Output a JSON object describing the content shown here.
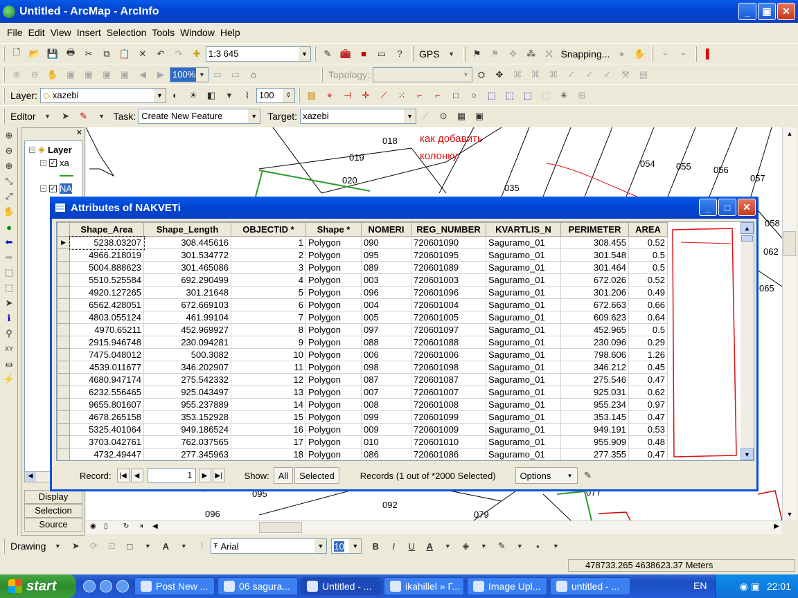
{
  "window": {
    "title": "Untitled - ArcMap - ArcInfo"
  },
  "menu": [
    "File",
    "Edit",
    "View",
    "Insert",
    "Selection",
    "Tools",
    "Window",
    "Help"
  ],
  "standard_toolbar": {
    "scale": "1:3 645",
    "gps_label": "GPS",
    "snapping_label": "Snapping..."
  },
  "layout_toolbar": {
    "zoom": "100%",
    "topology_label": "Topology:"
  },
  "effects_toolbar": {
    "layer_label": "Layer:",
    "layer_value": "xazebi",
    "transparency": "100"
  },
  "editor_toolbar": {
    "editor_label": "Editor",
    "task_label": "Task:",
    "task_value": "Create New Feature",
    "target_label": "Target:",
    "target_value": "xazebi"
  },
  "toc": {
    "layers_label": "Layer",
    "item1": "xa",
    "item2": "NA",
    "tabs": [
      "Display",
      "Selection",
      "Source"
    ]
  },
  "map": {
    "parcel_labels": [
      "018",
      "019",
      "020",
      "035",
      "054",
      "055",
      "056",
      "057",
      "058",
      "062",
      "065",
      "095",
      "092",
      "096",
      "079",
      "077"
    ],
    "annotation": [
      "как добавить",
      "колонку"
    ]
  },
  "attributes_dialog": {
    "title": "Attributes of NAKVETi",
    "columns": [
      "Shape_Area",
      "Shape_Length",
      "OBJECTID *",
      "Shape *",
      "NOMERI",
      "REG_NUMBER",
      "KVARTLIS_N",
      "PERIMETER",
      "AREA"
    ],
    "rows": [
      [
        "5238.03207",
        "308.445616",
        "1",
        "Polygon",
        "090",
        "720601090",
        "Saguramo_01",
        "308.455",
        "0.52"
      ],
      [
        "4966.218019",
        "301.534772",
        "2",
        "Polygon",
        "095",
        "720601095",
        "Saguramo_01",
        "301.548",
        "0.5"
      ],
      [
        "5004.888623",
        "301.465086",
        "3",
        "Polygon",
        "089",
        "720601089",
        "Saguramo_01",
        "301.464",
        "0.5"
      ],
      [
        "5510.525584",
        "692.290499",
        "4",
        "Polygon",
        "003",
        "720601003",
        "Saguramo_01",
        "672.026",
        "0.52"
      ],
      [
        "4920.127265",
        "301.21648",
        "5",
        "Polygon",
        "096",
        "720601096",
        "Saguramo_01",
        "301.206",
        "0.49"
      ],
      [
        "6562.428051",
        "672.669103",
        "6",
        "Polygon",
        "004",
        "720601004",
        "Saguramo_01",
        "672.663",
        "0.66"
      ],
      [
        "4803.055124",
        "461.99104",
        "7",
        "Polygon",
        "005",
        "720601005",
        "Saguramo_01",
        "609.623",
        "0.64"
      ],
      [
        "4970.65211",
        "452.969927",
        "8",
        "Polygon",
        "097",
        "720601097",
        "Saguramo_01",
        "452.965",
        "0.5"
      ],
      [
        "2915.946748",
        "230.094281",
        "9",
        "Polygon",
        "088",
        "720601088",
        "Saguramo_01",
        "230.096",
        "0.29"
      ],
      [
        "7475.048012",
        "500.3082",
        "10",
        "Polygon",
        "006",
        "720601006",
        "Saguramo_01",
        "798.606",
        "1.26"
      ],
      [
        "4539.011677",
        "346.202907",
        "11",
        "Polygon",
        "098",
        "720601098",
        "Saguramo_01",
        "346.212",
        "0.45"
      ],
      [
        "4680.947174",
        "275.542332",
        "12",
        "Polygon",
        "087",
        "720601087",
        "Saguramo_01",
        "275.546",
        "0.47"
      ],
      [
        "6232.556465",
        "925.043497",
        "13",
        "Polygon",
        "007",
        "720601007",
        "Saguramo_01",
        "925.031",
        "0.62"
      ],
      [
        "9655.801607",
        "955.237889",
        "14",
        "Polygon",
        "008",
        "720601008",
        "Saguramo_01",
        "955.234",
        "0.97"
      ],
      [
        "4678.265158",
        "353.152928",
        "15",
        "Polygon",
        "099",
        "720601099",
        "Saguramo_01",
        "353.145",
        "0.47"
      ],
      [
        "5325.401064",
        "949.186524",
        "16",
        "Polygon",
        "009",
        "720601009",
        "Saguramo_01",
        "949.191",
        "0.53"
      ],
      [
        "3703.042761",
        "762.037565",
        "17",
        "Polygon",
        "010",
        "720601010",
        "Saguramo_01",
        "955.909",
        "0.48"
      ],
      [
        "4732.49447",
        "277.345963",
        "18",
        "Polygon",
        "086",
        "720601086",
        "Saguramo_01",
        "277.355",
        "0.47"
      ]
    ],
    "record_label": "Record:",
    "record_value": "1",
    "show_label": "Show:",
    "show_all": "All",
    "show_selected": "Selected",
    "records_text": "Records (1 out of *2000 Selected)",
    "options_label": "Options"
  },
  "drawing_toolbar": {
    "drawing_label": "Drawing",
    "font": "Arial",
    "font_size": "10",
    "bold": "B",
    "italic": "I",
    "underline": "U"
  },
  "status": {
    "coordinates": "478733.265  4638623.37 Meters"
  },
  "taskbar": {
    "start_label": "start",
    "tasks": [
      "Post New ...",
      "06 sagura...",
      "Untitled - ...",
      "ikahillel » Г...",
      "Image Upl...",
      "untitled - ..."
    ],
    "lang": "EN",
    "clock": "22:01"
  }
}
